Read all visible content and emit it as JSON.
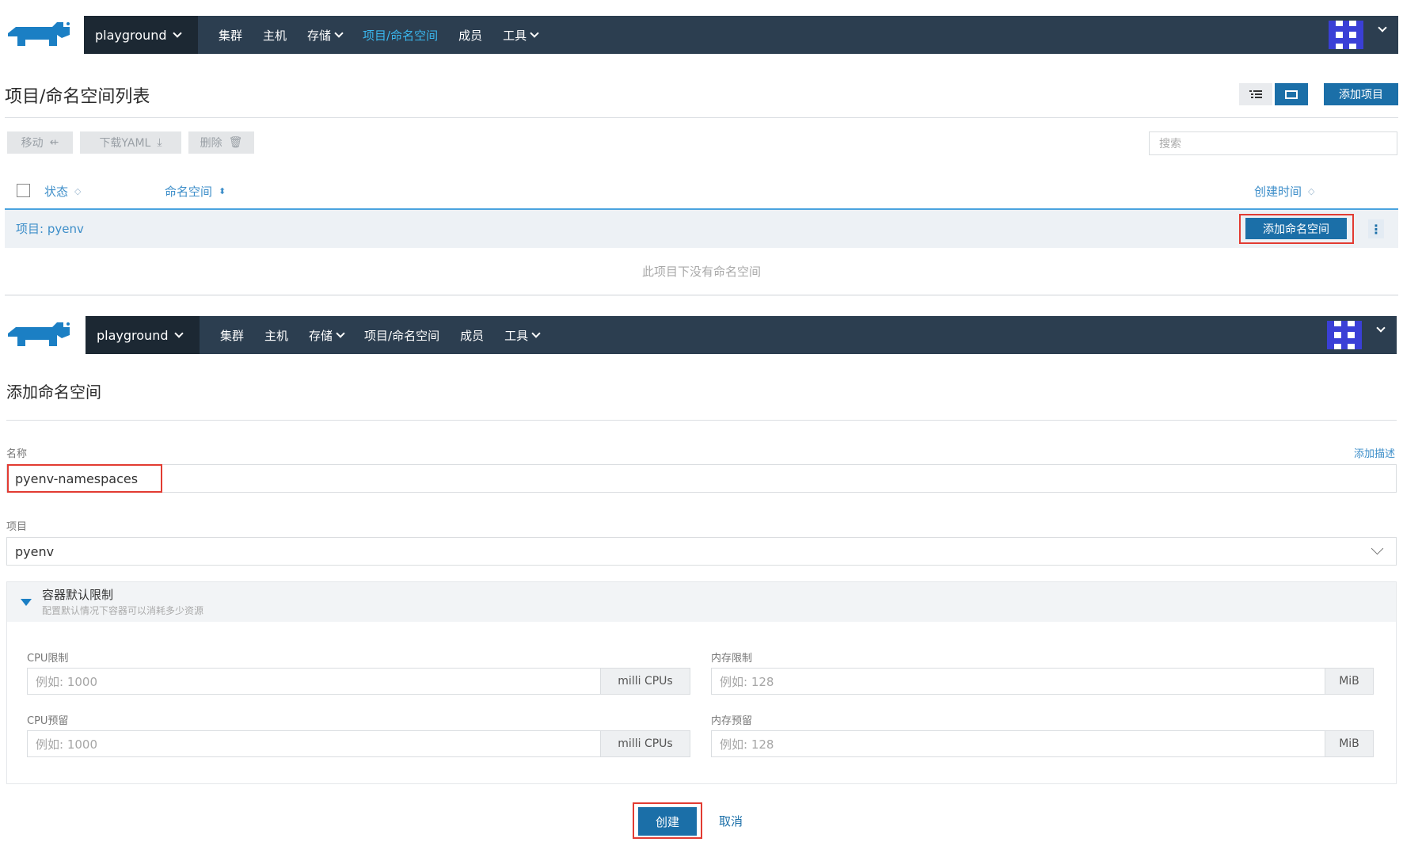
{
  "nav": {
    "cluster": "playground",
    "items": [
      "集群",
      "主机",
      "存储",
      "项目/命名空间",
      "成员",
      "工具"
    ]
  },
  "list_page": {
    "title": "项目/命名空间列表",
    "add_project": "添加项目",
    "actions": {
      "move": "移动",
      "download": "下载YAML",
      "delete": "删除"
    },
    "search_placeholder": "搜索",
    "columns": {
      "state": "状态",
      "namespace": "命名空间",
      "created": "创建时间"
    },
    "project_label": "项目: pyenv",
    "add_namespace": "添加命名空间",
    "empty": "此项目下没有命名空间"
  },
  "form": {
    "title": "添加命名空间",
    "name_label": "名称",
    "add_description": "添加描述",
    "name_value": "pyenv-namespaces",
    "project_label": "项目",
    "project_value": "pyenv",
    "section_title": "容器默认限制",
    "section_desc": "配置默认情况下容器可以消耗多少资源",
    "cpu_limit_label": "CPU限制",
    "cpu_limit_ph": "例如: 1000",
    "cpu_unit": "milli CPUs",
    "mem_limit_label": "内存限制",
    "mem_limit_ph": "例如: 128",
    "mem_unit": "MiB",
    "cpu_reserve_label": "CPU预留",
    "cpu_reserve_ph": "例如: 1000",
    "mem_reserve_label": "内存预留",
    "mem_reserve_ph": "例如: 128",
    "create": "创建",
    "cancel": "取消"
  },
  "colors": {
    "nav": "#2c3e50",
    "primary": "#1b6fa8",
    "link": "#3d8ec9",
    "highlight": "#e23b32"
  },
  "icons": [
    "rancher-logo-icon",
    "chevron-down-icon",
    "list-view-icon",
    "card-view-icon",
    "share-icon",
    "download-icon",
    "trash-icon",
    "sort-icon",
    "kebab-icon",
    "caret-down-icon"
  ]
}
